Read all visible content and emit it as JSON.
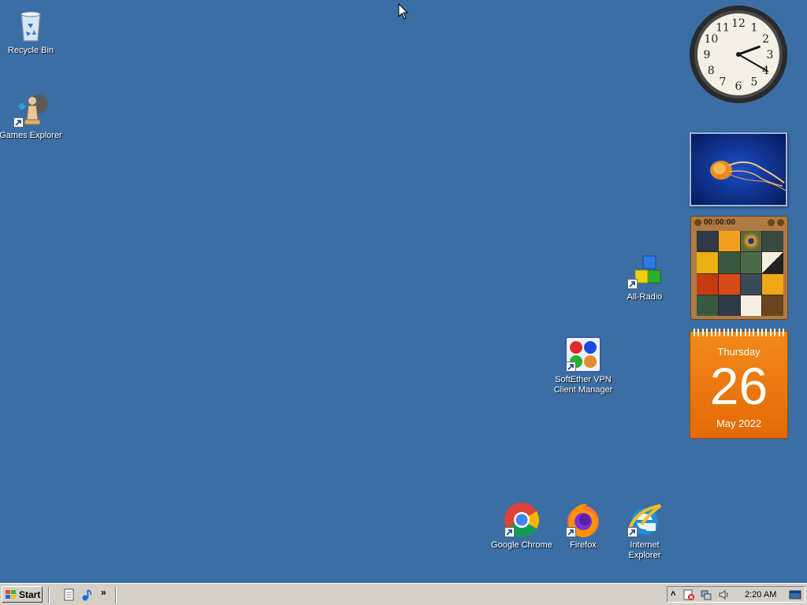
{
  "desktop": {
    "icons": [
      {
        "label": "Recycle Bin",
        "icon": "recycle-bin-icon"
      },
      {
        "label": "Games Explorer",
        "icon": "games-explorer-icon"
      },
      {
        "label": "All-Radio",
        "icon": "all-radio-icon"
      },
      {
        "label": "SoftEther VPN Client Manager",
        "icon": "softether-vpn-icon"
      },
      {
        "label": "Google Chrome",
        "icon": "chrome-icon"
      },
      {
        "label": "Firefox",
        "icon": "firefox-icon"
      },
      {
        "label": "Internet Explorer",
        "icon": "internet-explorer-icon"
      }
    ],
    "background_color": "#3a6ea5"
  },
  "gadgets": {
    "clock": {
      "hour": 2,
      "minute": 20,
      "numerals": [
        "12",
        "1",
        "2",
        "3",
        "4",
        "5",
        "6",
        "7",
        "8",
        "9",
        "10",
        "11"
      ]
    },
    "puzzle": {
      "timer": "00:00:00"
    },
    "calendar": {
      "weekday": "Thursday",
      "day": "26",
      "month_year": "May 2022"
    }
  },
  "taskbar": {
    "start_label": "Start",
    "overflow_label": "»",
    "clock": "2:20 AM",
    "tray_expand": "˄"
  }
}
